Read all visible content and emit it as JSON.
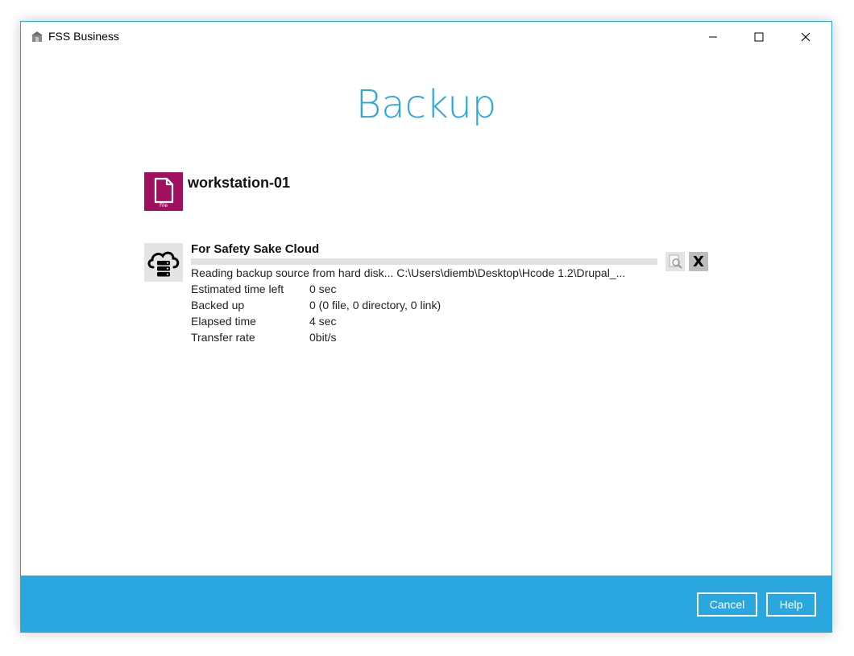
{
  "window": {
    "app_title": "FSS Business",
    "app_icon": "fss-logo-icon",
    "controls": [
      "minimize-icon",
      "maximize-icon",
      "close-icon"
    ]
  },
  "page": {
    "title": "Backup"
  },
  "backup_set": {
    "name": "workstation-01",
    "type_label": "File",
    "icon": "file-icon",
    "icon_color": "#a0105f"
  },
  "destination": {
    "name": "For Safety Sake Cloud",
    "icon": "cloud-server-icon",
    "status": "Reading backup source from hard disk... C:\\Users\\diemb\\Desktop\\Hcode 1.2\\Drupal_...",
    "progress_fraction": 0.0,
    "details": [
      {
        "label": "Estimated time left",
        "value": "0 sec"
      },
      {
        "label": "Backed up",
        "value": "0 (0 file, 0 directory, 0 link)"
      },
      {
        "label": "Elapsed time",
        "value": "4 sec"
      },
      {
        "label": "Transfer rate",
        "value": "0bit/s"
      }
    ],
    "actions": {
      "view_log_icon": "magnifier-log-icon",
      "stop_label": "X"
    }
  },
  "footer": {
    "cancel_label": "Cancel",
    "help_label": "Help"
  },
  "colors": {
    "accent": "#2aa7df",
    "footer_bg": "#2aa7df",
    "file_icon_bg": "#a0105f"
  }
}
